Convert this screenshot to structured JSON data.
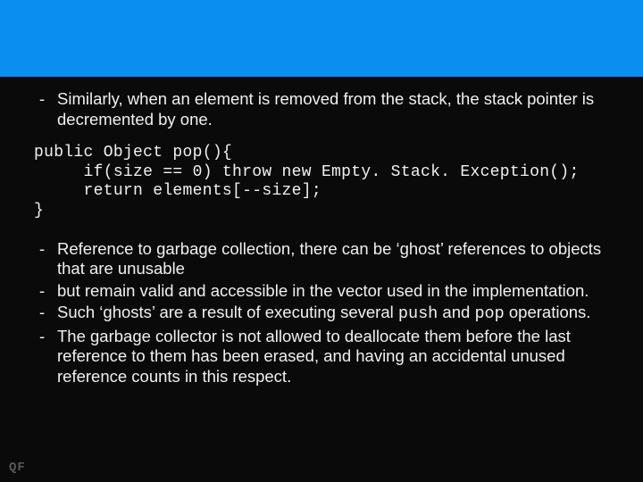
{
  "bullets_top": [
    "Similarly, when an element is removed from the stack, the stack pointer is decremented by one."
  ],
  "code": "public Object pop(){\n     if(size == 0) throw new Empty. Stack. Exception();\n     return elements[--size];\n}",
  "bullets_bottom": [
    "Reference to garbage collection, there can be ‘ghost’ references to objects that are unusable",
    "but remain valid and accessible in the vector used in the implementation.",
    {
      "pre": "Such ‘ghosts’ are a result of executing several ",
      "mono1": "push",
      "mid": " and ",
      "mono2": "pop",
      "post": " operations."
    },
    "The garbage collector is not allowed to deallocate them before the last reference to them has been erased, and having an accidental unused reference counts in this respect."
  ],
  "dash": "-",
  "logo": "QF"
}
